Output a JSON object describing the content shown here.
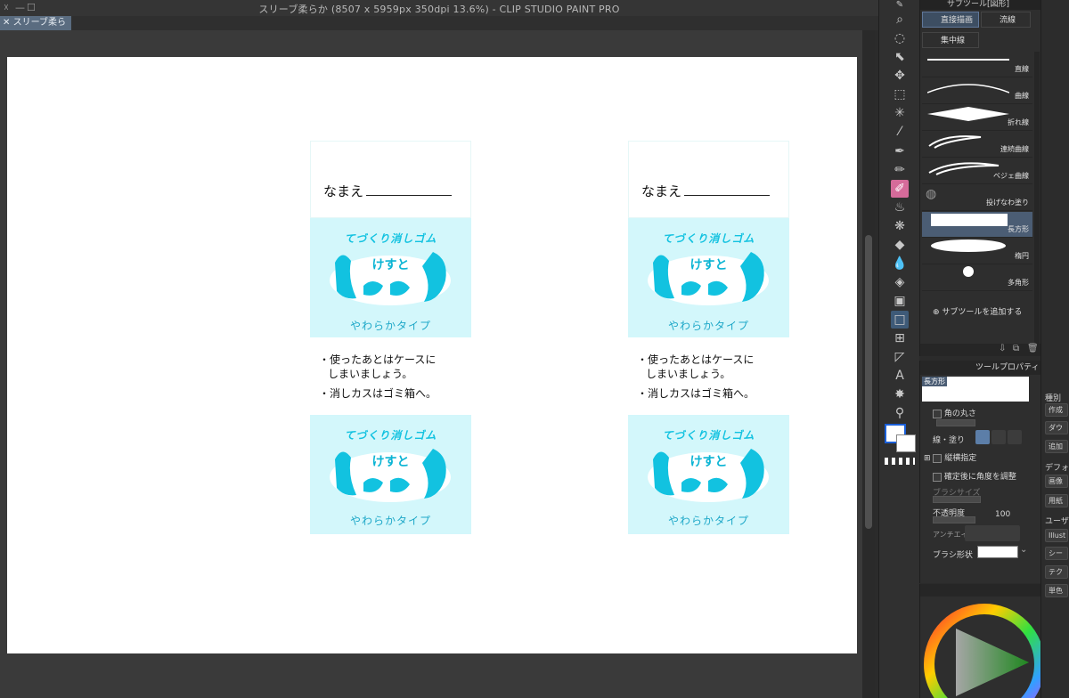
{
  "window": {
    "title": "スリーブ柔らか (8507 x 5959px 350dpi 13.6%)  - CLIP STUDIO PAINT PRO",
    "tab_label": "スリーブ柔らか",
    "controls": [
      "☓",
      "—",
      "☐"
    ]
  },
  "canvas": {
    "labels": [
      {
        "name_prompt": "なまえ",
        "logo_top": "てづくり消しゴム",
        "logo_main": "けすと",
        "logo_sub": "やわらかタイプ",
        "notes": [
          "・使ったあとはケースに",
          "しまいましょう。",
          "・消しカスはゴミ箱へ。"
        ],
        "logo2_top": "てづくり消しゴム",
        "logo2_main": "けすと",
        "logo2_sub": "やわらかタイプ"
      },
      {
        "name_prompt": "なまえ",
        "logo_top": "てづくり消しゴム",
        "logo_main": "けすと",
        "logo_sub": "やわらかタイプ",
        "notes": [
          "・使ったあとはケースに",
          "しまいましょう。",
          "・消しカスはゴミ箱へ。"
        ],
        "logo2_top": "てづくり消しゴム",
        "logo2_main": "けすと",
        "logo2_sub": "やわらかタイプ"
      }
    ]
  },
  "subtool_panel": {
    "title": "サブツール[図形]",
    "groups": [
      "直接描画",
      "流線",
      "集中線"
    ],
    "items": [
      "直線",
      "曲線",
      "折れ線",
      "連続曲線",
      "ベジェ曲線",
      "投げなわ塗り",
      "長方形",
      "楕円",
      "多角形"
    ],
    "active_item": "長方形",
    "add_label": "サブツールを追加する"
  },
  "tool_property": {
    "title": "ツールプロパティ",
    "tool_name": "長方形",
    "round_corner": "角の丸さ",
    "line_fill": "線・塗り",
    "aspect": "縦横指定",
    "angle_after": "確定後に角度を調整",
    "brush_size": "ブラシサイズ",
    "opacity_label": "不透明度",
    "opacity_value": "100",
    "antialias": "アンチエイ",
    "brush_shape": "ブラシ形状"
  },
  "right_panel": {
    "texts": [
      "種別",
      "デフォ",
      "ユーザ"
    ],
    "buttons": [
      "作成",
      "ダウ",
      "追加",
      "画像",
      "用紙",
      "Illust",
      "シー",
      "テク",
      "単色"
    ]
  },
  "colors": {
    "accent": "#12c2e0",
    "label_bg": "#d3f7fb",
    "active_tool": "#d56b9a",
    "selection": "#4b5d74"
  }
}
